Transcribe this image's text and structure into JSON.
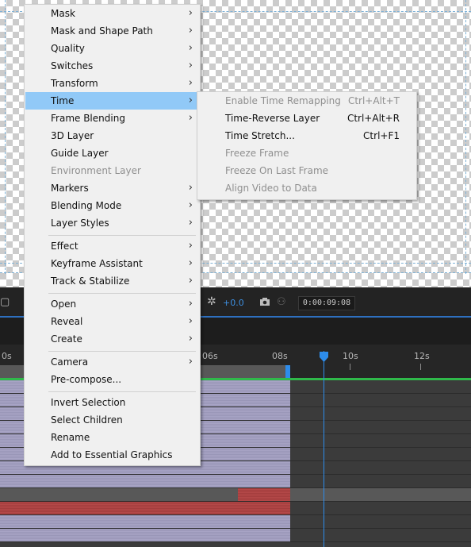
{
  "context_menu": {
    "items": [
      {
        "label": "Mask",
        "submenu": true
      },
      {
        "label": "Mask and Shape Path",
        "submenu": true
      },
      {
        "label": "Quality",
        "submenu": true
      },
      {
        "label": "Switches",
        "submenu": true
      },
      {
        "label": "Transform",
        "submenu": true
      },
      {
        "label": "Time",
        "submenu": true,
        "highlighted": true
      },
      {
        "label": "Frame Blending",
        "submenu": true
      },
      {
        "label": "3D Layer"
      },
      {
        "label": "Guide Layer"
      },
      {
        "label": "Environment Layer",
        "disabled": true
      },
      {
        "label": "Markers",
        "submenu": true
      },
      {
        "label": "Blending Mode",
        "submenu": true
      },
      {
        "label": "Layer Styles",
        "submenu": true
      },
      {
        "label": "Effect",
        "submenu": true
      },
      {
        "label": "Keyframe Assistant",
        "submenu": true
      },
      {
        "label": "Track & Stabilize",
        "submenu": true
      },
      {
        "label": "Open",
        "submenu": true
      },
      {
        "label": "Reveal",
        "submenu": true
      },
      {
        "label": "Create",
        "submenu": true
      },
      {
        "label": "Camera",
        "submenu": true
      },
      {
        "label": "Pre-compose..."
      },
      {
        "label": "Invert Selection"
      },
      {
        "label": "Select Children"
      },
      {
        "label": "Rename"
      },
      {
        "label": "Add to Essential Graphics"
      }
    ],
    "arrow_glyph": "›"
  },
  "time_submenu": {
    "items": [
      {
        "label": "Enable Time Remapping",
        "shortcut": "Ctrl+Alt+T",
        "disabled": true
      },
      {
        "label": "Time-Reverse Layer",
        "shortcut": "Ctrl+Alt+R"
      },
      {
        "label": "Time Stretch...",
        "shortcut": "Ctrl+F1"
      },
      {
        "label": "Freeze Frame",
        "shortcut": "",
        "disabled": true
      },
      {
        "label": "Freeze On Last Frame",
        "shortcut": "",
        "disabled": true
      },
      {
        "label": "Align Video to Data",
        "shortcut": "",
        "disabled": true
      }
    ]
  },
  "timeline": {
    "motion_blur_value": "+0.0",
    "timecode": "0:00:09:08",
    "ruler_labels": [
      "0s",
      "06s",
      "08s",
      "10s",
      "12s"
    ],
    "icons": {
      "motion_blur": "motion-blur-icon",
      "camera": "snapshot-camera-icon",
      "show_snapshot": "show-snapshot-icon",
      "playhead": "playhead-marker-icon"
    }
  },
  "colors": {
    "menu_highlight": "#91c9f7",
    "playhead": "#2d8ceb",
    "layer_purple": "#a7a3c4",
    "layer_red": "#b44848",
    "work_area_green": "#2fb94a"
  }
}
